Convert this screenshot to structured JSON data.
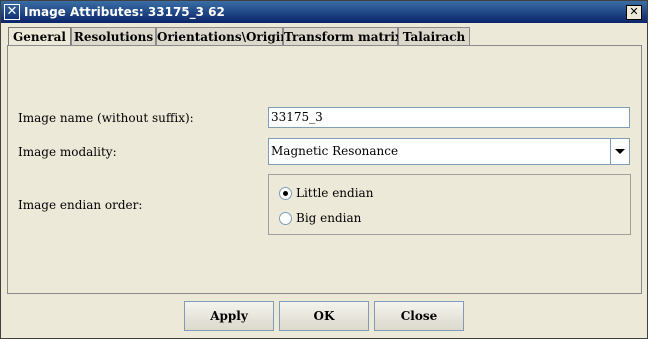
{
  "window": {
    "title": "Image Attributes: 33175_3 62",
    "close_glyph": "✕",
    "icon_glyph": "✕"
  },
  "tabs": [
    {
      "label": "General",
      "active": true
    },
    {
      "label": "Resolutions",
      "active": false
    },
    {
      "label": "Orientations\\Origin",
      "active": false
    },
    {
      "label": "Transform matrix",
      "active": false
    },
    {
      "label": "Talairach",
      "active": false
    }
  ],
  "general": {
    "image_name_label": "Image name (without suffix):",
    "image_name_value": "33175_3",
    "modality_label": "Image modality:",
    "modality_value": "Magnetic Resonance",
    "endian_label": "Image endian order:",
    "endian_options": [
      {
        "label": "Little endian",
        "selected": true
      },
      {
        "label": "Big endian",
        "selected": false
      }
    ]
  },
  "buttons": {
    "apply": "Apply",
    "ok": "OK",
    "close": "Close"
  }
}
